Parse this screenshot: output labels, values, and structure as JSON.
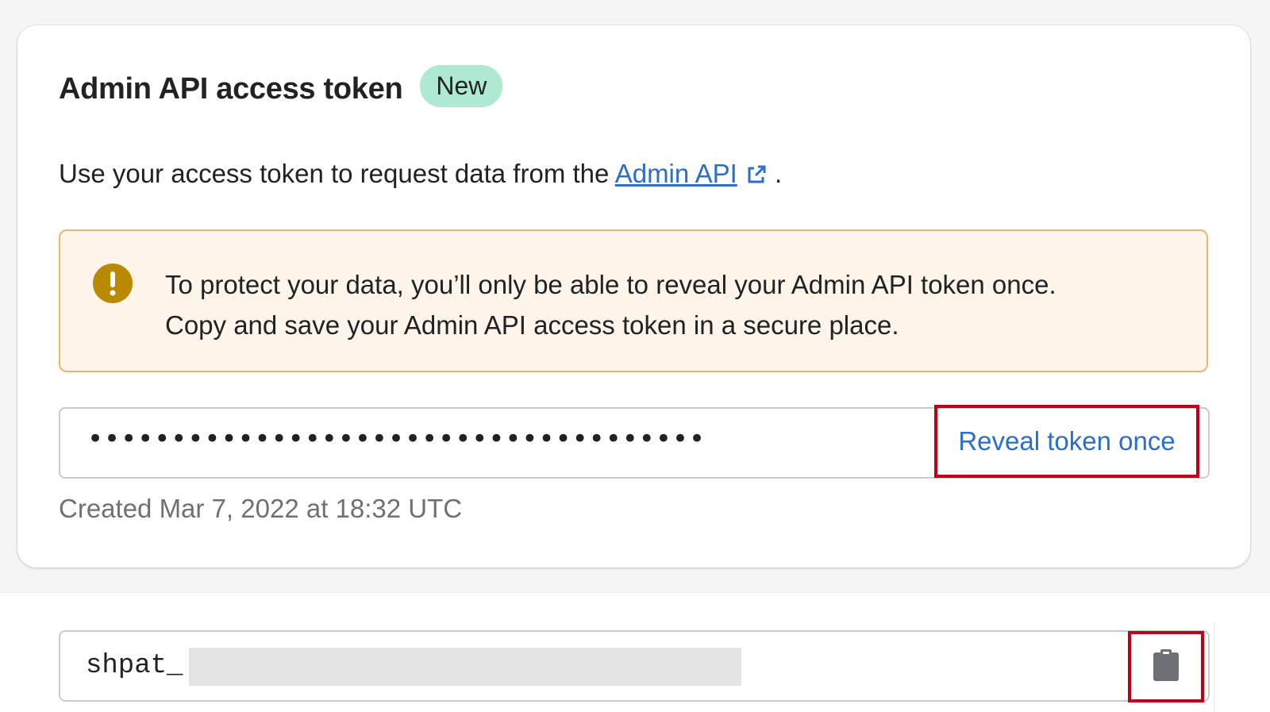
{
  "card": {
    "title": "Admin API access token",
    "badge": "New",
    "description_before": "Use your access token to request data from the ",
    "description_link": "Admin API",
    "description_after": " ."
  },
  "warning_banner": {
    "line1": "To protect your data, you’ll only be able to reveal your Admin API token once.",
    "line2": "Copy and save your Admin API access token in a secure place."
  },
  "token_field": {
    "masked_value": "•••••••••••••••••••••••••••••••••••••",
    "reveal_label": "Reveal token once",
    "created_text": "Created Mar 7, 2022 at 18:32 UTC"
  },
  "revealed_field": {
    "prefix": "shpat_"
  },
  "icons": {
    "warning": "exclamation-circle-icon",
    "external": "external-link-icon",
    "copy": "clipboard-icon"
  },
  "colors": {
    "badge_bg": "#aee9d1",
    "link": "#2c6ecb",
    "banner_bg": "#fff5ea",
    "banner_border": "#e8b778",
    "warning_icon": "#b98900",
    "highlight_box": "#c0001a"
  }
}
